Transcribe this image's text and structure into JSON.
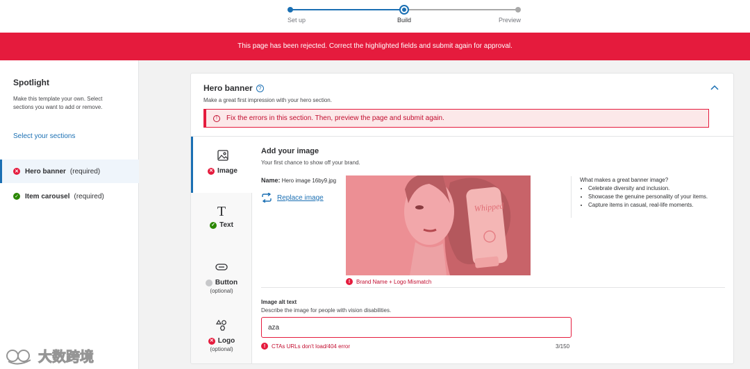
{
  "stepper": {
    "steps": [
      {
        "label": "Set up",
        "state": "done"
      },
      {
        "label": "Build",
        "state": "current"
      },
      {
        "label": "Preview",
        "state": "todo"
      }
    ]
  },
  "banner": {
    "message": "This page has been rejected. Correct the highlighted fields and submit again for approval."
  },
  "sidebar": {
    "title": "Spotlight",
    "description": "Make this template your own. Select sections you want to add or remove.",
    "select_link": "Select your sections",
    "items": [
      {
        "name": "Hero banner",
        "required": "(required)",
        "status": "error"
      },
      {
        "name": "Item carousel",
        "required": "(required)",
        "status": "ok"
      }
    ]
  },
  "section": {
    "title": "Hero banner",
    "subtitle": "Make a great first impression with your hero section.",
    "error": "Fix the errors in this section. Then, preview the page and submit again."
  },
  "tabs": [
    {
      "label": "Image",
      "status": "error",
      "icon": "image-icon"
    },
    {
      "label": "Text",
      "status": "ok",
      "icon": "text-icon"
    },
    {
      "label": "Button",
      "optional": "(optional)",
      "status": "none",
      "icon": "button-icon"
    },
    {
      "label": "Logo",
      "optional": "(optional)",
      "status": "error",
      "icon": "shapes-icon"
    }
  ],
  "image_panel": {
    "title": "Add your image",
    "subtitle": "Your first chance to show off your brand.",
    "name_label": "Name:",
    "file_name": "Hero image 16by9.jpg",
    "replace_label": "Replace image",
    "image_error": "Brand Name + Logo Mismatch",
    "product_text": "Whipped",
    "tips_title": "What makes a great banner image?",
    "tips": [
      "Celebrate diversity and inclusion.",
      "Showcase the genuine personality of your items.",
      "Capture items in casual, real-life moments."
    ]
  },
  "alt_text": {
    "label": "Image alt text",
    "description": "Describe the image for people with vision disabilities.",
    "value": "aza",
    "error": "CTAs URLs don't load/404 error",
    "counter": "3/150"
  },
  "watermark": {
    "text": "大数跨境"
  },
  "colors": {
    "brand_blue": "#1a6fb3",
    "error_red": "#e51b3d",
    "success_green": "#2a8703"
  }
}
